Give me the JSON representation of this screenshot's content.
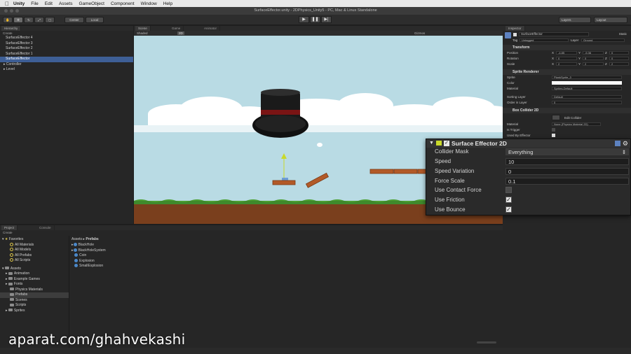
{
  "menubar": {
    "app": "Unity",
    "items": [
      "File",
      "Edit",
      "Assets",
      "GameObject",
      "Component",
      "Window",
      "Help"
    ]
  },
  "window_title": "SurfaceEffector.unity - 2DPhysics_Unity5 - PC, Mac & Linux Standalone",
  "toolbar": {
    "pivot": "Center",
    "space": "Local",
    "layers": "Layers",
    "layout": "Layout"
  },
  "hierarchy": {
    "tab": "Hierarchy",
    "create": "Create",
    "items": [
      "SurfaceEffector 4",
      "SurfaceEffector 3",
      "SurfaceEffector 2",
      "SurfaceEffector 1",
      "SurfaceEffector",
      "Controller",
      "Level"
    ],
    "selected_index": 4
  },
  "scene_tabs": [
    "Scene",
    "Game",
    "Animator"
  ],
  "scene_toolbar": {
    "shading": "Shaded",
    "mode": "2D",
    "gizmos": "Gizmos"
  },
  "inspector": {
    "tab": "Inspector",
    "object_name": "SurfaceEffector",
    "static_label": "Static",
    "tag_label": "Tag",
    "tag_value": "Untagged",
    "layer_label": "Layer",
    "layer_value": "Ground",
    "transform": {
      "title": "Transform",
      "position": {
        "label": "Position",
        "x": "-4.85",
        "y": "-5.36",
        "z": "0"
      },
      "rotation": {
        "label": "Rotation",
        "x": "0",
        "y": "0",
        "z": "0"
      },
      "scale": {
        "label": "Scale",
        "x": "2",
        "y": "2",
        "z": "2"
      }
    },
    "sprite_renderer": {
      "title": "Sprite Renderer",
      "sprite_label": "Sprite",
      "sprite_value": "PlankSprite_0",
      "color_label": "Color",
      "material_label": "Material",
      "material_value": "Sprites-Default",
      "sorting_label": "Sorting Layer",
      "sorting_value": "Default",
      "order_label": "Order in Layer",
      "order_value": "0"
    },
    "box_collider": {
      "title": "Box Collider 2D",
      "edit": "Edit Collider",
      "material_label": "Material",
      "material_value": "None (Physics Material 2D)",
      "trigger_label": "Is Trigger",
      "effector_label": "Used By Effector"
    }
  },
  "surface_effector": {
    "title": "Surface Effector 2D",
    "fields": [
      {
        "label": "Collider Mask",
        "value": "Everything"
      },
      {
        "label": "Speed",
        "value": "10"
      },
      {
        "label": "Speed Variation",
        "value": "0"
      },
      {
        "label": "Force Scale",
        "value": "0.1"
      }
    ],
    "checks": [
      {
        "label": "Use Contact Force",
        "checked": false
      },
      {
        "label": "Use Friction",
        "checked": true
      },
      {
        "label": "Use Bounce",
        "checked": true
      }
    ]
  },
  "project": {
    "tabs": [
      "Project",
      "Console"
    ],
    "create": "Create",
    "favorites_title": "Favorites",
    "favorites": [
      "All Materials",
      "All Models",
      "All Prefabs",
      "All Scripts"
    ],
    "assets_title": "Assets",
    "folders": [
      "Animation",
      "Example Games",
      "Fonts",
      "Physics Materials",
      "Prefabs",
      "Scenes",
      "Scripts",
      "Sprites"
    ],
    "selected_folder_index": 4,
    "breadcrumb": [
      "Assets",
      "Prefabs"
    ],
    "items": [
      "BlackHole",
      "BlackHoleSystem",
      "Coin",
      "Explosion",
      "SmallExplosion"
    ]
  },
  "watermark": "aparat.com/ghahvekashi",
  "colors": {
    "selection": "#3e5f96",
    "sky": "#b9dbe4",
    "ground": "#7a3f1d",
    "grass": "#3f8a2c",
    "plank": "#b25a28"
  }
}
